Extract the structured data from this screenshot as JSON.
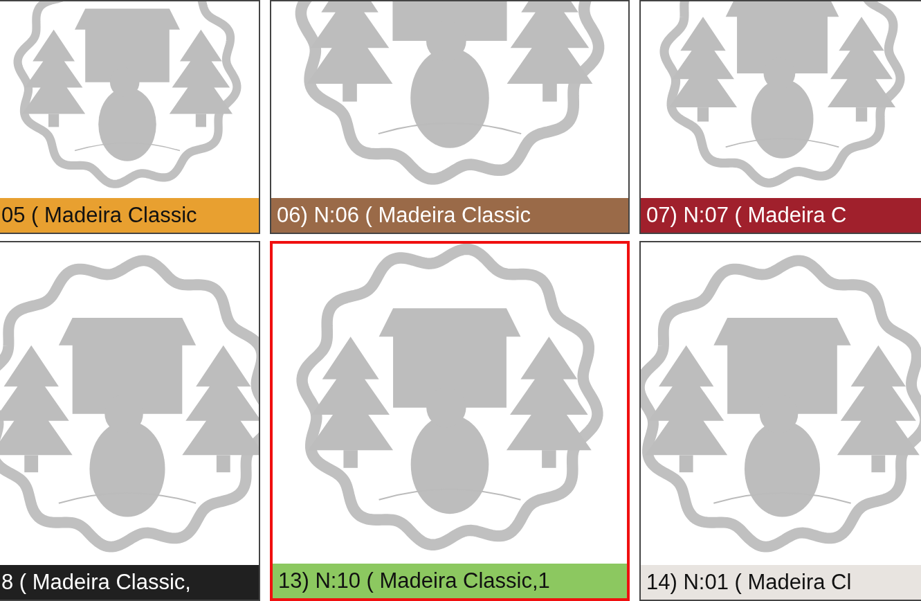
{
  "tiles": [
    {
      "caption": "05 ( Madeira Classic",
      "color": "#e8a030",
      "selected": false
    },
    {
      "caption": "06) N:06 ( Madeira Classic",
      "color": "#9a6a48",
      "selected": false
    },
    {
      "caption": "07) N:07 ( Madeira C",
      "color": "#a0202c",
      "selected": false
    },
    {
      "caption": "8 ( Madeira Classic,",
      "color": "#202020",
      "selected": false
    },
    {
      "caption": "13) N:10 ( Madeira Classic,1",
      "color": "#8cc860",
      "selected": true
    },
    {
      "caption": "14) N:01 ( Madeira Cl",
      "color": "#e8e4e0",
      "selected": false
    }
  ]
}
